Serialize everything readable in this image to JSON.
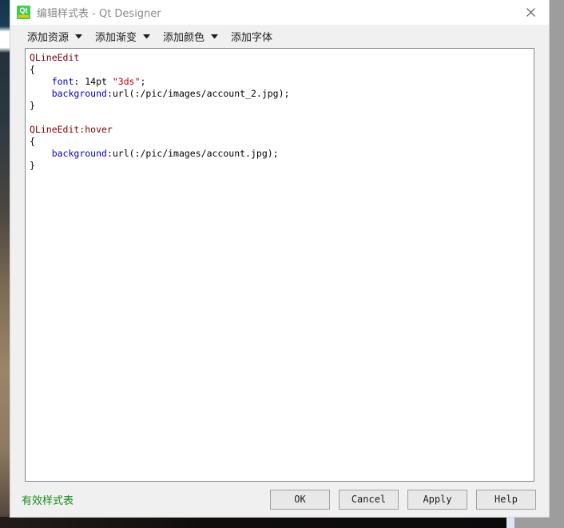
{
  "window": {
    "title": "编辑样式表 - Qt Designer",
    "app_icon": "qt-logo-icon",
    "logo_text": "Qt",
    "close_icon": "close-icon"
  },
  "toolbar": {
    "items": [
      {
        "label": "添加资源",
        "has_dropdown": true,
        "icon": "chevron-down-icon"
      },
      {
        "label": "添加渐变",
        "has_dropdown": true,
        "icon": "chevron-down-icon"
      },
      {
        "label": "添加颜色",
        "has_dropdown": true,
        "icon": "chevron-down-icon"
      },
      {
        "label": "添加字体",
        "has_dropdown": false,
        "icon": ""
      }
    ]
  },
  "editor": {
    "lines": [
      {
        "tokens": [
          {
            "text": "QLineEdit",
            "type": "sel"
          }
        ]
      },
      {
        "tokens": [
          {
            "text": "{",
            "type": "brace"
          }
        ]
      },
      {
        "tokens": [
          {
            "text": "    ",
            "type": "plain"
          },
          {
            "text": "font",
            "type": "prop"
          },
          {
            "text": ": 14pt ",
            "type": "plain"
          },
          {
            "text": "\"3ds\"",
            "type": "str"
          },
          {
            "text": ";",
            "type": "plain"
          }
        ]
      },
      {
        "tokens": [
          {
            "text": "    ",
            "type": "plain"
          },
          {
            "text": "background",
            "type": "prop"
          },
          {
            "text": ":url(:/pic/images/account_2.jpg);",
            "type": "plain"
          }
        ]
      },
      {
        "tokens": [
          {
            "text": "}",
            "type": "brace"
          }
        ]
      },
      {
        "tokens": [
          {
            "text": "",
            "type": "plain"
          }
        ]
      },
      {
        "tokens": [
          {
            "text": "QLineEdit:hover",
            "type": "sel"
          }
        ]
      },
      {
        "tokens": [
          {
            "text": "{",
            "type": "brace"
          }
        ]
      },
      {
        "tokens": [
          {
            "text": "    ",
            "type": "plain"
          },
          {
            "text": "background",
            "type": "prop"
          },
          {
            "text": ":url(:/pic/images/account.jpg);",
            "type": "plain"
          }
        ]
      },
      {
        "tokens": [
          {
            "text": "}",
            "type": "brace"
          }
        ]
      }
    ]
  },
  "footer": {
    "status": "有效样式表",
    "buttons": [
      {
        "label": "OK"
      },
      {
        "label": "Cancel"
      },
      {
        "label": "Apply"
      },
      {
        "label": "Help"
      }
    ]
  },
  "colors": {
    "selector": "#800000",
    "property": "#0000c0",
    "string": "#c00000",
    "status_valid": "#1a8a1a",
    "qt_green": "#41cd52",
    "qt_yellow": "#f5c400",
    "title_text": "#8a8a8a"
  }
}
